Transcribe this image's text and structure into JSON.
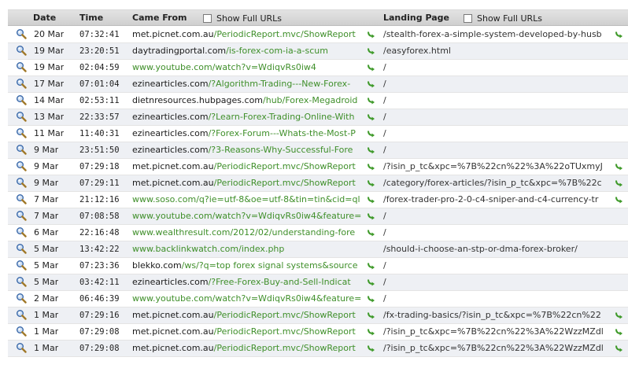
{
  "header": {
    "date": "Date",
    "time": "Time",
    "came_from": "Came From",
    "show_full_urls_1": "Show Full URLs",
    "landing_page": "Landing Page",
    "show_full_urls_2": "Show Full URLs"
  },
  "colors": {
    "link_green": "#3f8f2a",
    "row_alt": "#eef0f4",
    "header_bg": "#d8d8d8"
  },
  "rows": [
    {
      "date": "20 Mar",
      "time": "07:32:41",
      "host": "met.picnet.com.au",
      "path": "/PeriodicReport.mvc/ShowReport",
      "green_host": false,
      "landing": "/stealth-forex-a-simple-system-developed-by-husb",
      "landing_link": true
    },
    {
      "date": "19 Mar",
      "time": "23:20:51",
      "host": "daytradingportal.com",
      "path": "/is-forex-com-ia-a-scum",
      "green_host": false,
      "landing": "/easyforex.html",
      "landing_link": false
    },
    {
      "date": "19 Mar",
      "time": "02:04:59",
      "host": "www.youtube.com",
      "path": "/watch?v=WdiqvRs0iw4",
      "green_host": true,
      "landing": "/",
      "landing_link": false
    },
    {
      "date": "17 Mar",
      "time": "07:01:04",
      "host": "ezinearticles.com",
      "path": "/?Algorithm-Trading---New-Forex-",
      "green_host": false,
      "landing": "/",
      "landing_link": false
    },
    {
      "date": "14 Mar",
      "time": "02:53:11",
      "host": "dietnresources.hubpages.com",
      "path": "/hub/Forex-Megadroid",
      "green_host": false,
      "landing": "/",
      "landing_link": false
    },
    {
      "date": "13 Mar",
      "time": "22:33:57",
      "host": "ezinearticles.com",
      "path": "/?Learn-Forex-Trading-Online-With",
      "green_host": false,
      "landing": "/",
      "landing_link": false
    },
    {
      "date": "11 Mar",
      "time": "11:40:31",
      "host": "ezinearticles.com",
      "path": "/?Forex-Forum---Whats-the-Most-P",
      "green_host": false,
      "landing": "/",
      "landing_link": false
    },
    {
      "date": "9 Mar",
      "time": "23:51:50",
      "host": "ezinearticles.com",
      "path": "/?3-Reasons-Why-Successful-Fore",
      "green_host": false,
      "landing": "/",
      "landing_link": false
    },
    {
      "date": "9 Mar",
      "time": "07:29:18",
      "host": "met.picnet.com.au",
      "path": "/PeriodicReport.mvc/ShowReport",
      "green_host": false,
      "landing": "/?isin_p_tc&xpc=%7B%22cn%22%3A%22oTUxmyJ",
      "landing_link": true
    },
    {
      "date": "9 Mar",
      "time": "07:29:11",
      "host": "met.picnet.com.au",
      "path": "/PeriodicReport.mvc/ShowReport",
      "green_host": false,
      "landing": "/category/forex-articles/?isin_p_tc&xpc=%7B%22c",
      "landing_link": true
    },
    {
      "date": "7 Mar",
      "time": "21:12:16",
      "host": "www.soso.com",
      "path": "/q?ie=utf-8&oe=utf-8&tin=tin&cid=ql",
      "green_host": true,
      "landing": "/forex-trader-pro-2-0-c4-sniper-and-c4-currency-tr",
      "landing_link": true
    },
    {
      "date": "7 Mar",
      "time": "07:08:58",
      "host": "www.youtube.com",
      "path": "/watch?v=WdiqvRs0iw4&feature=",
      "green_host": true,
      "landing": "/",
      "landing_link": false
    },
    {
      "date": "6 Mar",
      "time": "22:16:48",
      "host": "www.wealthresult.com",
      "path": "/2012/02/understanding-fore",
      "green_host": true,
      "landing": "/",
      "landing_link": false
    },
    {
      "date": "5 Mar",
      "time": "13:42:22",
      "host": "www.backlinkwatch.com",
      "path": "/index.php",
      "green_host": true,
      "landing": "/should-i-choose-an-stp-or-dma-forex-broker/",
      "landing_link": false,
      "no_go": true
    },
    {
      "date": "5 Mar",
      "time": "07:23:36",
      "host": "blekko.com",
      "path": "/ws/?q=top forex signal systems&source",
      "green_host": false,
      "landing": "/",
      "landing_link": false
    },
    {
      "date": "5 Mar",
      "time": "03:42:11",
      "host": "ezinearticles.com",
      "path": "/?Free-Forex-Buy-and-Sell-Indicat",
      "green_host": false,
      "landing": "/",
      "landing_link": false
    },
    {
      "date": "2 Mar",
      "time": "06:46:39",
      "host": "www.youtube.com",
      "path": "/watch?v=WdiqvRs0iw4&feature=",
      "green_host": true,
      "landing": "/",
      "landing_link": false
    },
    {
      "date": "1 Mar",
      "time": "07:29:16",
      "host": "met.picnet.com.au",
      "path": "/PeriodicReport.mvc/ShowReport",
      "green_host": false,
      "landing": "/fx-trading-basics/?isin_p_tc&xpc=%7B%22cn%22",
      "landing_link": true
    },
    {
      "date": "1 Mar",
      "time": "07:29:08",
      "host": "met.picnet.com.au",
      "path": "/PeriodicReport.mvc/ShowReport",
      "green_host": false,
      "landing": "/?isin_p_tc&xpc=%7B%22cn%22%3A%22WzzMZdl",
      "landing_link": true
    },
    {
      "date": "1 Mar",
      "time": "07:29:08",
      "host": "met.picnet.com.au",
      "path": "/PeriodicReport.mvc/ShowReport",
      "green_host": false,
      "landing": "/?isin_p_tc&xpc=%7B%22cn%22%3A%22WzzMZdl",
      "landing_link": true
    }
  ]
}
